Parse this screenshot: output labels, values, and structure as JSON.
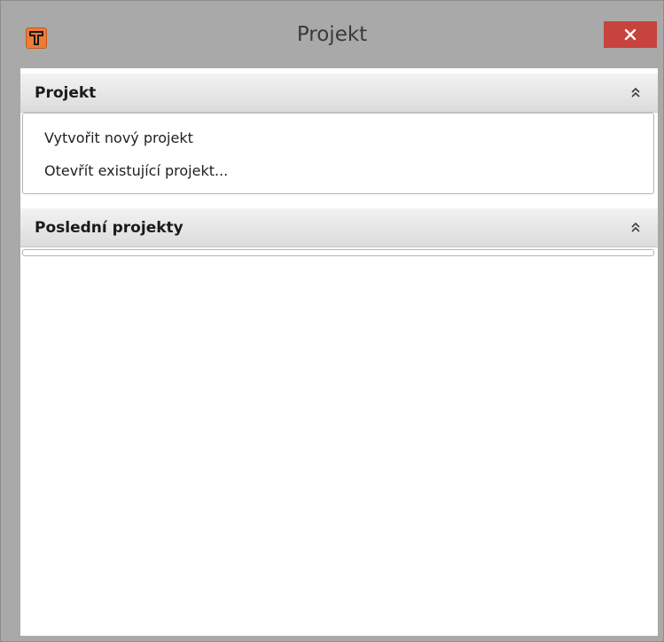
{
  "window": {
    "title": "Projekt",
    "icon": "t-app-icon",
    "close": "close-icon",
    "close_color": "#c7433e"
  },
  "sections": [
    {
      "title": "Projekt",
      "items": [
        "Vytvořit nový projekt",
        "Otevřít existující projekt..."
      ]
    },
    {
      "title": "Poslední projekty",
      "items": []
    }
  ]
}
